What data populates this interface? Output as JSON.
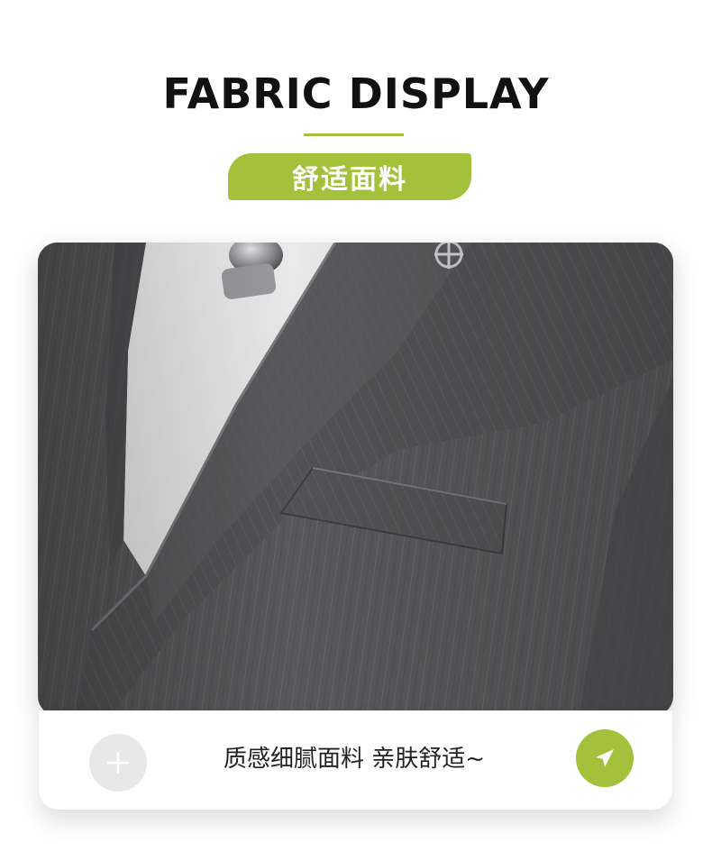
{
  "header": {
    "title": "FABRIC DISPLAY",
    "subtitle_badge": "舒适面料"
  },
  "photo": {
    "subject": "grey pinstripe suit jacket close-up"
  },
  "caption": {
    "text": "质感细腻面料 亲肤舒适~",
    "left_icon": "plus-icon",
    "right_icon": "send-icon"
  },
  "colors": {
    "accent": "#a3c13a",
    "title": "#111111",
    "fabric": "#5a5a5c"
  }
}
